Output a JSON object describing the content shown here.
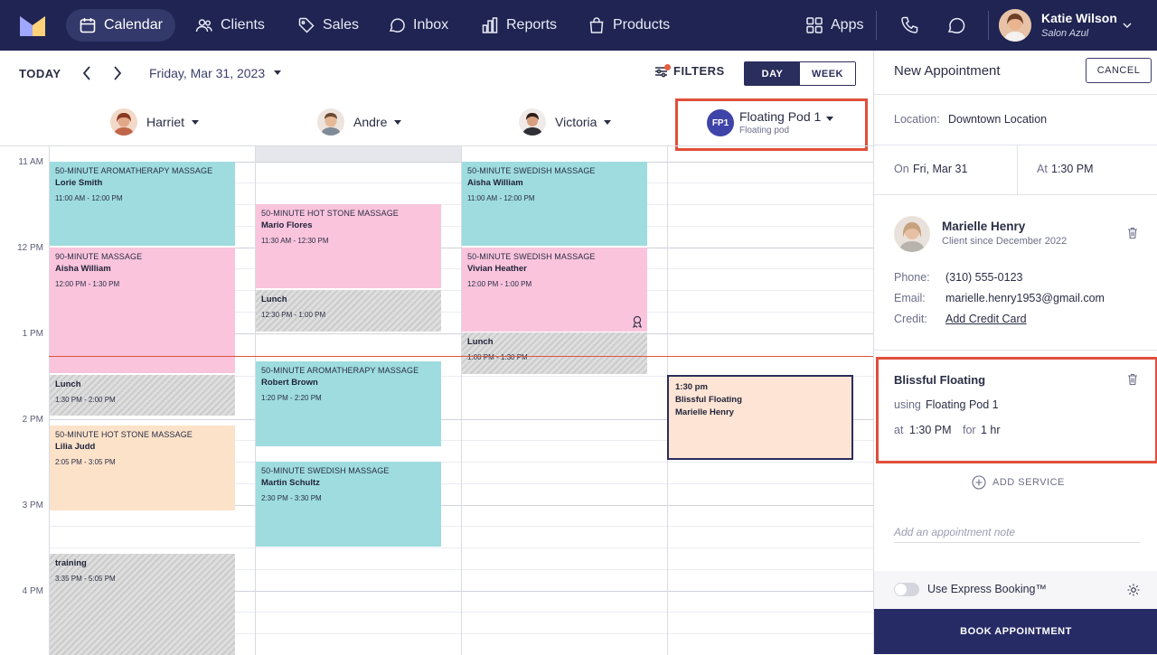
{
  "nav": {
    "items": [
      {
        "label": "Calendar",
        "icon": "calendar-icon"
      },
      {
        "label": "Clients",
        "icon": "clients-icon"
      },
      {
        "label": "Sales",
        "icon": "tag-icon"
      },
      {
        "label": "Inbox",
        "icon": "chat-bubble-icon"
      },
      {
        "label": "Reports",
        "icon": "bar-chart-icon"
      },
      {
        "label": "Products",
        "icon": "shopping-bag-icon"
      }
    ],
    "apps_label": "Apps",
    "user_name": "Katie Wilson",
    "user_org": "Salon Azul",
    "colors": {
      "background": "#1f2452",
      "active": "#33396a"
    }
  },
  "toolbar": {
    "today_label": "TODAY",
    "date_label": "Friday, Mar 31, 2023",
    "filters_label": "FILTERS",
    "view_day": "DAY",
    "view_week": "WEEK"
  },
  "staff": [
    {
      "name": "Harriet"
    },
    {
      "name": "Andre"
    },
    {
      "name": "Victoria"
    }
  ],
  "pod": {
    "initials": "FP1",
    "name": "Floating Pod 1",
    "subtitle": "Floating pod"
  },
  "hours": [
    "11 AM",
    "12 PM",
    "1 PM",
    "2 PM",
    "3 PM",
    "4 PM"
  ],
  "events": {
    "harriet": [
      {
        "type": "50-MINUTE AROMATHERAPY MASSAGE",
        "client": "Lorie Smith",
        "time": "11:00 AM - 12:00 PM"
      },
      {
        "type": "90-MINUTE MASSAGE",
        "client": "Aisha William",
        "time": "12:00 PM - 1:30 PM"
      },
      {
        "type": "",
        "client": "Lunch",
        "time": "1:30 PM - 2:00 PM"
      },
      {
        "type": "50-MINUTE HOT STONE MASSAGE",
        "client": "Lilia Judd",
        "time": "2:05 PM - 3:05 PM"
      },
      {
        "type": "",
        "client": "training",
        "time": "3:35 PM - 5:05 PM"
      }
    ],
    "andre": [
      {
        "type": "50-MINUTE HOT STONE MASSAGE",
        "client": "Mario Flores",
        "time": "11:30 AM - 12:30 PM"
      },
      {
        "type": "",
        "client": "Lunch",
        "time": "12:30 PM - 1:00 PM"
      },
      {
        "type": "50-MINUTE AROMATHERAPY MASSAGE",
        "client": "Robert Brown",
        "time": "1:20 PM - 2:20 PM"
      },
      {
        "type": "50-MINUTE SWEDISH MASSAGE",
        "client": "Martin Schultz",
        "time": "2:30 PM - 3:30 PM"
      }
    ],
    "victoria": [
      {
        "type": "50-MINUTE SWEDISH MASSAGE",
        "client": "Aisha William",
        "time": "11:00 AM - 12:00 PM"
      },
      {
        "type": "50-MINUTE SWEDISH MASSAGE",
        "client": "Vivian Heather",
        "time": "12:00 PM - 1:00 PM"
      },
      {
        "type": "",
        "client": "Lunch",
        "time": "1:00 PM - 1:30 PM"
      }
    ],
    "pod": {
      "time": "1:30 pm",
      "service": "Blissful Floating",
      "client": "Marielle Henry"
    }
  },
  "event_colors": {
    "teal": "#9edcdf",
    "pink": "#f9c4dc",
    "peach": "#fbe2c9",
    "pod": "#fde4d4",
    "now_line": "#e0543d"
  },
  "panel": {
    "title": "New Appointment",
    "cancel_label": "CANCEL",
    "location_label": "Location:",
    "location_value": "Downtown Location",
    "on_label": "On",
    "on_value": "Fri, Mar 31",
    "at_label": "At",
    "at_value": "1:30 PM",
    "client": {
      "name": "Marielle Henry",
      "since": "Client since December 2022",
      "phone_label": "Phone:",
      "phone": "(310) 555-0123",
      "email_label": "Email:",
      "email": "marielle.henry1953@gmail.com",
      "credit_label": "Credit:",
      "credit_link": "Add Credit Card"
    },
    "service": {
      "title": "Blissful Floating",
      "using_label": "using",
      "using_value": "Floating Pod 1",
      "at_label": "at",
      "at_value": "1:30 PM",
      "for_label": "for",
      "for_value": "1 hr"
    },
    "add_service_label": "ADD SERVICE",
    "note_placeholder": "Add an appointment note",
    "express_label": "Use Express Booking™",
    "book_label": "BOOK APPOINTMENT",
    "highlight_color": "#e14f3a"
  }
}
